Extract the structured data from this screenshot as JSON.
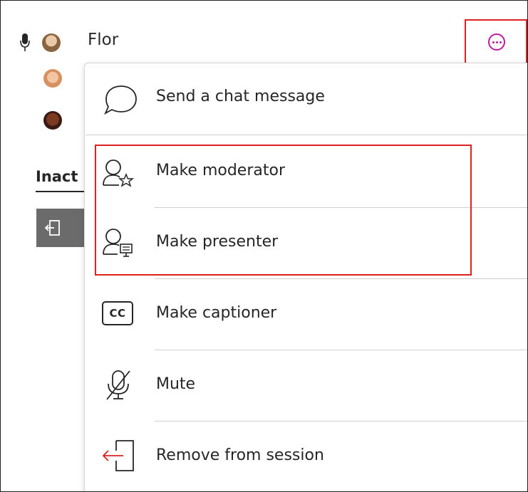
{
  "participant": {
    "name": "Flor"
  },
  "section": {
    "inactive_label": "Inact"
  },
  "menu": {
    "items": [
      {
        "label": "Send a chat message",
        "icon": "chat-bubble-icon"
      },
      {
        "label": "Make moderator",
        "icon": "user-star-icon"
      },
      {
        "label": "Make presenter",
        "icon": "user-presenter-icon"
      },
      {
        "label": "Make captioner",
        "icon": "closed-caption-icon",
        "glyph": "CC"
      },
      {
        "label": "Mute",
        "icon": "microphone-off-icon"
      },
      {
        "label": "Remove from session",
        "icon": "exit-door-icon"
      }
    ]
  },
  "colors": {
    "accent": "#c0199f",
    "highlight": "#e02020",
    "exit_arrow": "#e02020"
  }
}
